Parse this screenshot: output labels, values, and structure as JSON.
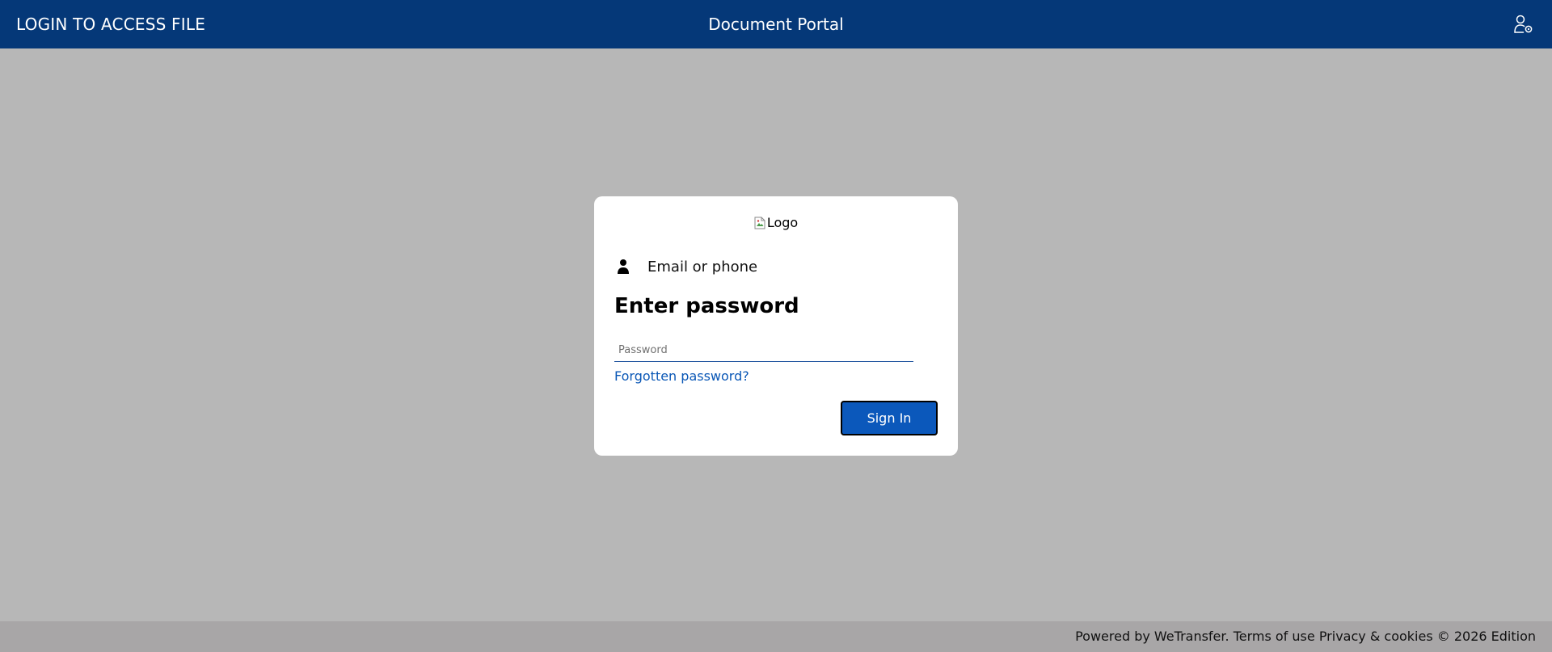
{
  "header": {
    "left_title": "LOGIN TO ACCESS FILE",
    "center_title": "Document Portal",
    "account_icon": "user-settings-icon"
  },
  "card": {
    "logo_alt": "Logo",
    "identity_icon": "person-icon",
    "identity_text": "Email or phone",
    "title": "Enter password",
    "password_placeholder": "Password",
    "password_value": "",
    "forgot_link": "Forgotten password?",
    "signin_label": "Sign In"
  },
  "footer": {
    "powered_by": "Powered by WeTransfer.",
    "terms_link": "Terms of use",
    "privacy_link": "Privacy & cookies",
    "edition": "© 2026 Edition"
  },
  "colors": {
    "header_bg": "#053878",
    "page_bg": "#b7b7b7",
    "footer_bg": "#a8a6a7",
    "link": "#0a57b6",
    "button_bg": "#0b58bb"
  }
}
